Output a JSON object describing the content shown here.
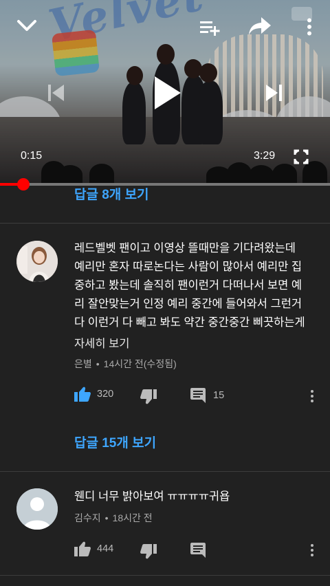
{
  "player": {
    "current_time": "0:15",
    "duration": "3:29",
    "progress_fraction": 0.0717,
    "banner_text": "Velvet"
  },
  "comments": [
    {
      "show_replies_label": "답글 8개 보기"
    },
    {
      "text": "레드벨벳 팬이고 이영상 뜰때만을 기다려왔는데\n예리만 혼자 따로논다는 사람이 많아서 예리만 집\n중하고 봤는데 솔직히 팬이런거 다떠나서 보면 예\n리 잘안맞는거 인정 예리 중간에 들어와서 그런거\n다 이런거 다 빼고 봐도 약간 중간중간 삐끗하는게",
      "read_more": "자세히 보기",
      "author": "은별",
      "time": "14시간 전(수정됨)",
      "likes": "320",
      "reply_count": "15",
      "show_replies_label": "답글 15개 보기",
      "like_color": "#3ea6ff"
    },
    {
      "text": "웬디 너무 밝아보여 ㅠㅠㅠㅠ귀욥",
      "author": "김수지",
      "time": "18시간 전",
      "likes": "444"
    }
  ],
  "icons": {
    "collapse": "chevron-down-icon",
    "add_to_queue": "playlist-add-icon",
    "share": "share-icon",
    "menu": "more-vert-icon",
    "previous": "skip-previous-icon",
    "play": "play-icon",
    "next": "skip-next-icon",
    "fullscreen": "fullscreen-icon",
    "like": "thumb-up-icon",
    "dislike": "thumb-down-icon",
    "reply": "comment-icon"
  },
  "colors": {
    "accent_blue": "#3ea6ff",
    "progress_red": "#ff0000",
    "background": "#212121"
  }
}
